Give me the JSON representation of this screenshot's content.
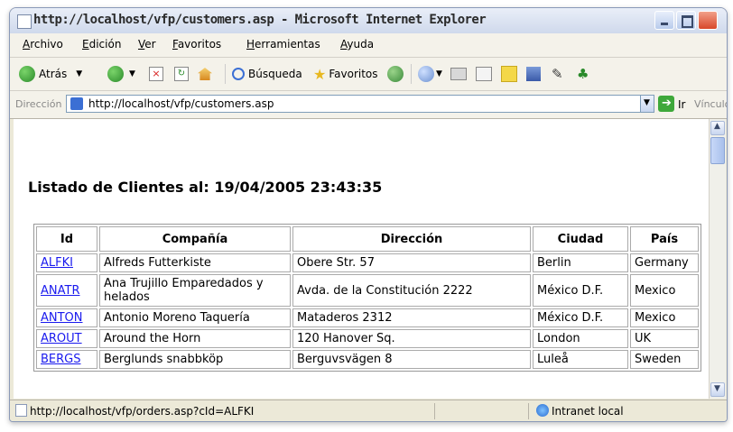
{
  "window": {
    "title": "http://localhost/vfp/customers.asp - Microsoft Internet Explorer"
  },
  "menu": [
    "Archivo",
    "Edición",
    "Ver",
    "Favoritos",
    "Herramientas",
    "Ayuda"
  ],
  "toolbar": {
    "back_label": "Atrás",
    "search_label": "Búsqueda",
    "favorites_label": "Favoritos"
  },
  "address": {
    "label": "Dirección",
    "url": "http://localhost/vfp/customers.asp",
    "go_label": "Ir",
    "links_label": "Vínculos"
  },
  "page": {
    "heading": "Listado de Clientes al: 19/04/2005 23:43:35",
    "columns": [
      "Id",
      "Compañía",
      "Dirección",
      "Ciudad",
      "País"
    ],
    "rows": [
      {
        "id": "ALFKI",
        "company": "Alfreds Futterkiste",
        "address": "Obere Str. 57",
        "city": "Berlin",
        "country": "Germany"
      },
      {
        "id": "ANATR",
        "company": "Ana Trujillo Emparedados y helados",
        "address": "Avda. de la Constitución 2222",
        "city": "México D.F.",
        "country": "Mexico"
      },
      {
        "id": "ANTON",
        "company": "Antonio Moreno Taquería",
        "address": "Mataderos 2312",
        "city": "México D.F.",
        "country": "Mexico"
      },
      {
        "id": "AROUT",
        "company": "Around the Horn",
        "address": "120 Hanover Sq.",
        "city": "London",
        "country": "UK"
      },
      {
        "id": "BERGS",
        "company": "Berglunds snabbköp",
        "address": "Berguvsvägen 8",
        "city": "Luleå",
        "country": "Sweden"
      }
    ]
  },
  "status": {
    "text": "http://localhost/vfp/orders.asp?cId=ALFKI",
    "zone": "Intranet local"
  },
  "colors": {
    "link": "#1a1aee",
    "title_bar": "#cfd9ec",
    "close_button": "#d8482a"
  }
}
